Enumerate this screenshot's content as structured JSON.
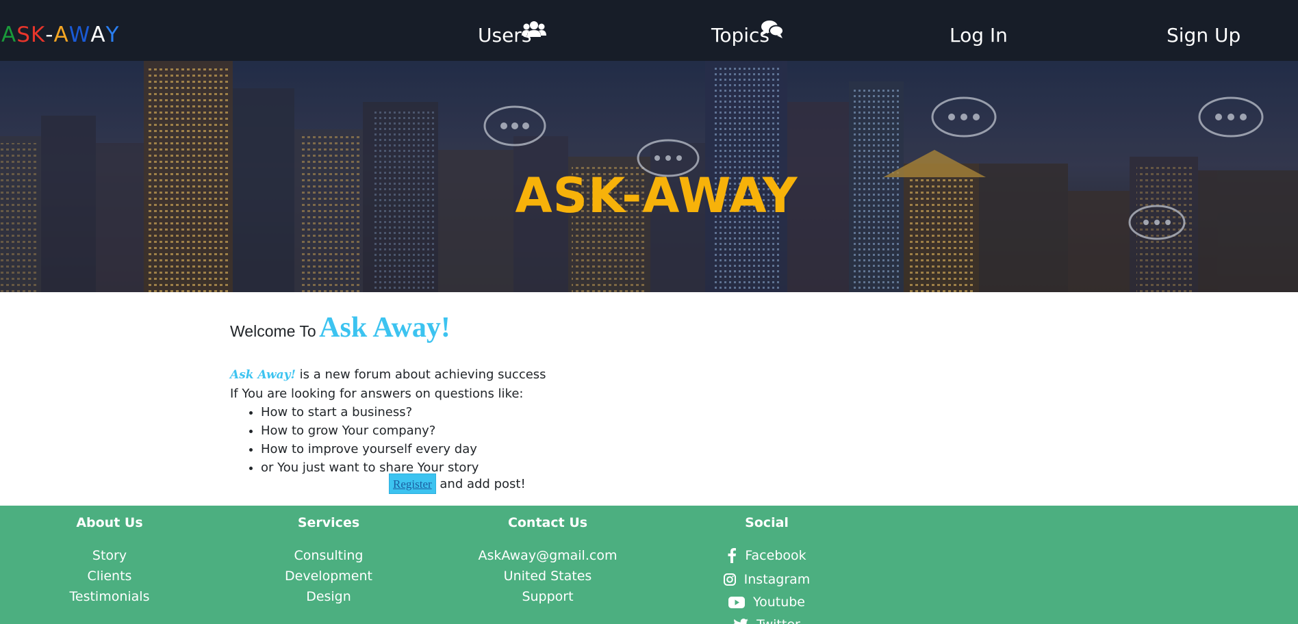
{
  "navbar": {
    "logo_letters": [
      {
        "char": "A",
        "color": "#1a9a3a"
      },
      {
        "char": "S",
        "color": "#e8352b"
      },
      {
        "char": "K",
        "color": "#e8352b"
      },
      {
        "char": "-",
        "color": "#ffffff"
      },
      {
        "char": "A",
        "color": "#f5a623"
      },
      {
        "char": "W",
        "color": "#1a5ad6"
      },
      {
        "char": "A",
        "color": "#ffffff"
      },
      {
        "char": "Y",
        "color": "#2a7ef0"
      }
    ],
    "links": {
      "users": "Users",
      "topics": "Topics",
      "login": "Log In",
      "signup": "Sign Up"
    },
    "icons": {
      "users": "users-icon",
      "topics": "comments-icon"
    }
  },
  "hero": {
    "title": "ASK-AWAY",
    "title_color": "#f7b20a"
  },
  "welcome": {
    "prefix": "Welcome To",
    "brand": "Ask Away!",
    "brand_color": "#3cc3f0"
  },
  "intro": {
    "brand_script": "Ask Away!",
    "line1_rest": " is a new forum about achieving success",
    "line2": "If You are looking for answers on questions like:",
    "questions": [
      "How to start a business?",
      "How to grow Your company?",
      "How to improve yourself every day",
      "or You just want to share Your story"
    ],
    "register_label": "Register",
    "register_suffix": " and add post!"
  },
  "footer": {
    "background": "#4caf80",
    "about": {
      "heading": "About Us",
      "items": [
        "Story",
        "Clients",
        "Testimonials"
      ]
    },
    "services": {
      "heading": "Services",
      "items": [
        "Consulting",
        "Development",
        "Design"
      ]
    },
    "contact": {
      "heading": "Contact Us",
      "items": [
        "AskAway@gmail.com",
        "United States",
        "Support"
      ]
    },
    "social": {
      "heading": "Social",
      "items": [
        {
          "label": "Facebook",
          "icon": "facebook-icon"
        },
        {
          "label": "Instagram",
          "icon": "instagram-icon"
        },
        {
          "label": "Youtube",
          "icon": "youtube-icon"
        },
        {
          "label": "Twitter",
          "icon": "twitter-icon"
        }
      ]
    }
  }
}
